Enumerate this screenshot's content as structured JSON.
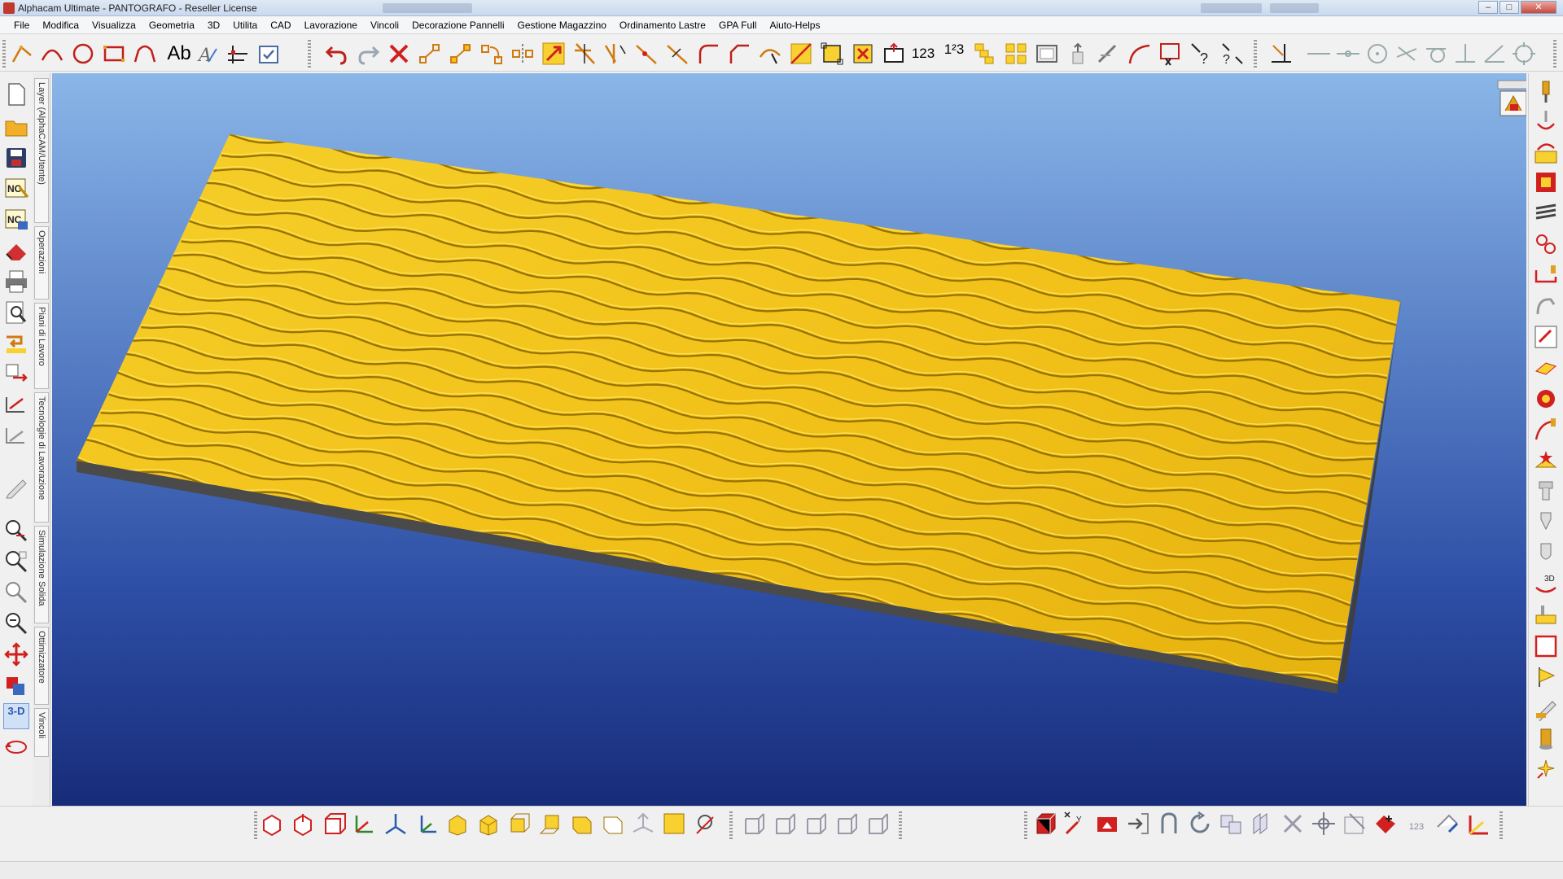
{
  "window": {
    "title": "Alphacam Ultimate - PANTOGRAFO - Reseller License",
    "minimize_label": "–",
    "maximize_label": "□",
    "close_label": "✕"
  },
  "menu": {
    "items": [
      "File",
      "Modifica",
      "Visualizza",
      "Geometria",
      "3D",
      "Utilita",
      "CAD",
      "Lavorazione",
      "Vincoli",
      "Decorazione Pannelli",
      "Gestione Magazzino",
      "Ordinamento Lastre",
      "GPA Full",
      "Aiuto-Helps"
    ]
  },
  "toolbar": {
    "text_tool_label": "Ab",
    "number_tool_label": "123",
    "renumber_tool_label": "1²3"
  },
  "side_tabs": {
    "items": [
      "Layer (AlphaCAM/Utente)",
      "Operazioni",
      "Piani di Lavoro",
      "Tecnologie di Lavorazione",
      "Simulazione Solida",
      "Ottimizzatore",
      "Vincoli"
    ]
  },
  "left_toolbar": {
    "view_3d_label": "3-D"
  },
  "bottom_toolbar": {
    "number_label": "123"
  },
  "viewport": {
    "model": "wave-panel",
    "panel_color": "#f2c21a",
    "background_top": "#8ab6e8",
    "background_bottom": "#172c79"
  },
  "status": {
    "text": ""
  }
}
